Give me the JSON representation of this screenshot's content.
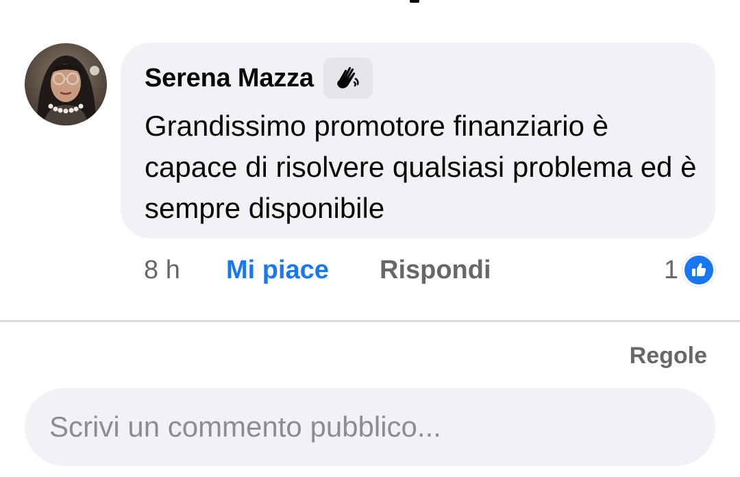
{
  "comment": {
    "author": "Serena Mazza",
    "badge_icon": "waving-hand-icon",
    "text": "Grandissimo promotore finanziario è capace di risolvere qualsiasi problema ed è sempre disponibile",
    "time": "8 h",
    "like_label": "Mi piace",
    "reply_label": "Rispondi",
    "reaction_count": "1",
    "reaction_icon": "like-thumb-icon"
  },
  "footer": {
    "rules_label": "Regole",
    "input_placeholder": "Scrivi un commento pubblico..."
  },
  "colors": {
    "accent": "#1877f2",
    "bubble": "#f0f2f5",
    "secondary_text": "#65676b"
  }
}
